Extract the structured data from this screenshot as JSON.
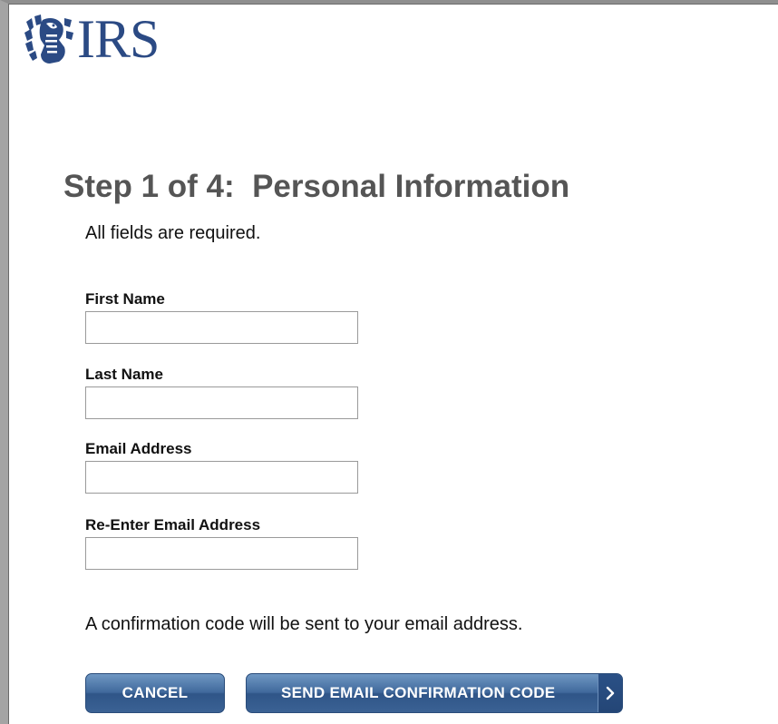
{
  "header": {
    "logo_text": "IRS",
    "logo_icon": "eagle-emblem-icon"
  },
  "main": {
    "title": "Step 1 of 4:  Personal Information",
    "required_note": "All fields are required.",
    "fields": [
      {
        "label": "First Name",
        "value": "",
        "placeholder": ""
      },
      {
        "label": "Last Name",
        "value": "",
        "placeholder": ""
      },
      {
        "label": "Email Address",
        "value": "",
        "placeholder": ""
      },
      {
        "label": "Re-Enter Email Address",
        "value": "",
        "placeholder": ""
      }
    ],
    "confirmation_note": "A confirmation code will be sent to your email address."
  },
  "actions": {
    "cancel_label": "CANCEL",
    "send_label": "SEND EMAIL CONFIRMATION CODE",
    "send_icon": "chevron-right-icon"
  },
  "colors": {
    "brand_blue": "#2b4a84",
    "button_blue": "#3b6294",
    "title_gray": "#555555"
  }
}
